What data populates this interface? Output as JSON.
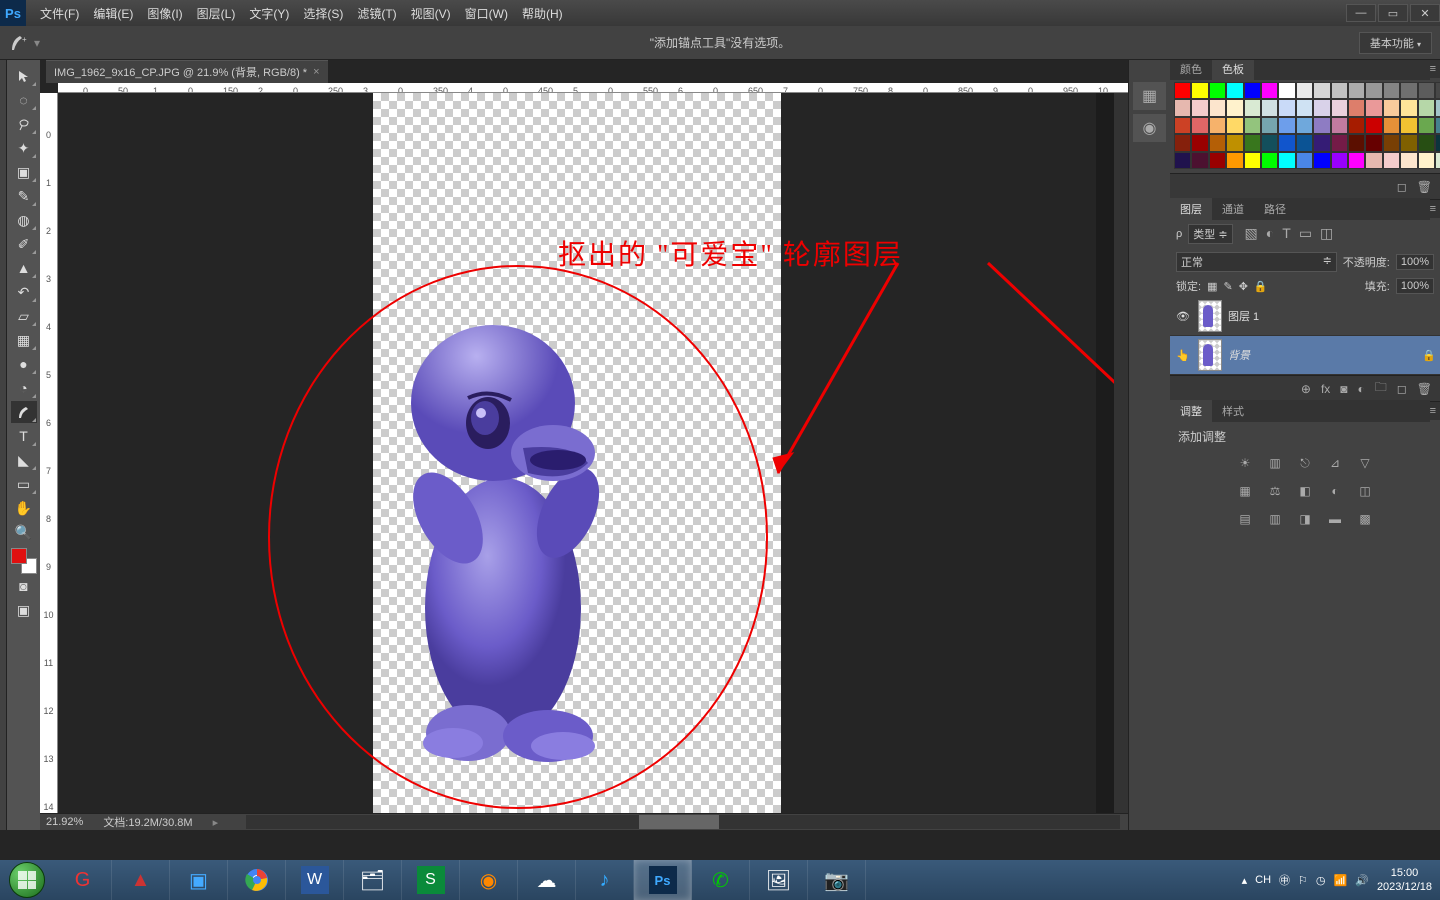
{
  "app": {
    "name": "Ps"
  },
  "menu": [
    "文件(F)",
    "编辑(E)",
    "图像(I)",
    "图层(L)",
    "文字(Y)",
    "选择(S)",
    "滤镜(T)",
    "视图(V)",
    "窗口(W)",
    "帮助(H)"
  ],
  "options": {
    "message": "\"添加锚点工具\"没有选项。",
    "workspace": "基本功能"
  },
  "tab": {
    "title": "IMG_1962_9x16_CP.JPG @ 21.9% (背景, RGB/8) *"
  },
  "status": {
    "zoom": "21.92%",
    "doc": "文档:19.2M/30.8M"
  },
  "annotation": "抠出的 \"可爱宝\" 轮廓图层",
  "panels": {
    "color_tab1": "颜色",
    "color_tab2": "色板",
    "layers_tab1": "图层",
    "layers_tab2": "通道",
    "layers_tab3": "路径",
    "type_label": "类型",
    "blend": "正常",
    "opacity_label": "不透明度:",
    "opacity_val": "100%",
    "lock_label": "锁定:",
    "fill_label": "填充:",
    "fill_val": "100%",
    "layer1": "图层 1",
    "layer_bg": "背景",
    "adj_tab1": "调整",
    "adj_tab2": "样式",
    "adj_title": "添加调整"
  },
  "ruler_h": [
    "50",
    "0",
    "50",
    "1",
    "0",
    "150",
    "2",
    "0",
    "250",
    "3",
    "0",
    "350",
    "4",
    "0",
    "450",
    "5",
    "0",
    "550",
    "6",
    "0",
    "650",
    "7",
    "0",
    "750",
    "8",
    "0",
    "850",
    "9",
    "0",
    "950",
    "10"
  ],
  "ruler_v": [
    "0",
    "1",
    "2",
    "3",
    "4",
    "5",
    "6",
    "7",
    "8",
    "9",
    "10",
    "11",
    "12",
    "13",
    "14"
  ],
  "tray": {
    "ime": "CH",
    "time": "15:00",
    "date": "2023/12/18"
  },
  "swatches": [
    "#ff0000",
    "#ffff00",
    "#00ff00",
    "#00ffff",
    "#0000ff",
    "#ff00ff",
    "#ffffff",
    "#ebebeb",
    "#d6d6d6",
    "#c2c2c2",
    "#adadad",
    "#999999",
    "#858585",
    "#707070",
    "#5c5c5c",
    "#474747",
    "#333333",
    "#000000",
    "#e6b8af",
    "#f4cccc",
    "#fce5cd",
    "#fff2cc",
    "#d9ead3",
    "#d0e0e3",
    "#c9daf8",
    "#cfe2f3",
    "#d9d2e9",
    "#ead1dc",
    "#dd7e6b",
    "#ea9999",
    "#f9cb9c",
    "#ffe599",
    "#b6d7a8",
    "#a2c4c9",
    "#a4c2f4",
    "#9fc5e8",
    "#cc4125",
    "#e06666",
    "#f6b26b",
    "#ffd966",
    "#93c47d",
    "#76a5af",
    "#6d9eeb",
    "#6fa8dc",
    "#8e7cc3",
    "#c27ba0",
    "#a61c00",
    "#cc0000",
    "#e69138",
    "#f1c232",
    "#6aa84f",
    "#45818e",
    "#3c78d8",
    "#3d85c6",
    "#85200c",
    "#990000",
    "#b45f06",
    "#bf9000",
    "#38761d",
    "#134f5c",
    "#1155cc",
    "#0b5394",
    "#351c75",
    "#741b47",
    "#5b0f00",
    "#660000",
    "#783f04",
    "#7f6000",
    "#274e13",
    "#0c343d",
    "#1c4587",
    "#073763",
    "#20124d",
    "#4c1130",
    "#980000",
    "#ff9900",
    "#ffff00",
    "#00ff00",
    "#00ffff",
    "#4a86e8",
    "#0000ff",
    "#9900ff",
    "#ff00ff",
    "#e6b8af",
    "#f4cccc",
    "#fce5cd",
    "#fff2cc",
    "#d9ead3",
    "#d0e0e3"
  ]
}
